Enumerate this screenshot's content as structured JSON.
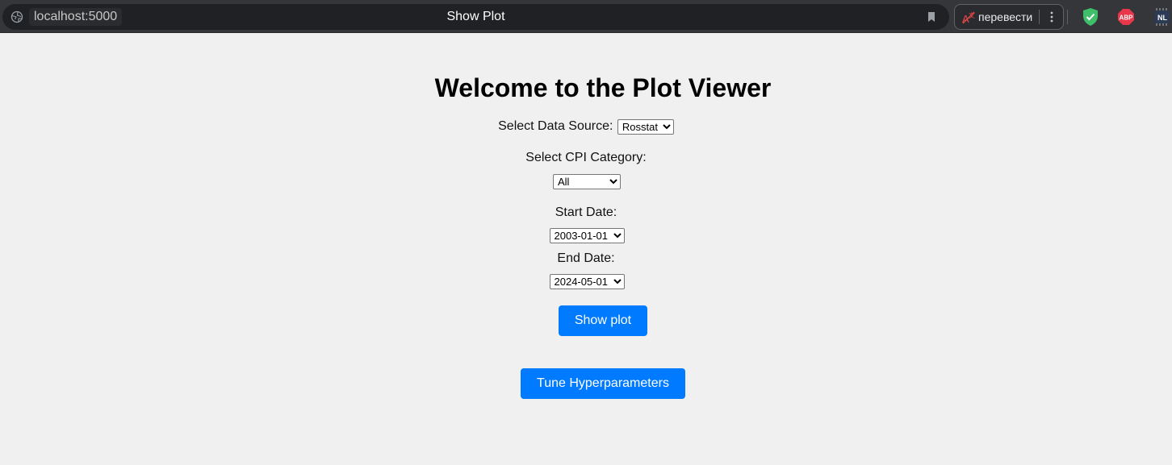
{
  "browser": {
    "url": "localhost:5000",
    "tab_title": "Show Plot",
    "translate_label": "перевести",
    "extensions": [
      {
        "name": "shield-extension",
        "color": "#3fbf6a"
      },
      {
        "name": "adblock-plus",
        "label": "ABP",
        "color": "#e8374a"
      },
      {
        "name": "nl-extension",
        "label": "NL"
      }
    ]
  },
  "page": {
    "heading": "Welcome to the Plot Viewer",
    "data_source": {
      "label": "Select Data Source:",
      "selected": "Rosstat"
    },
    "cpi_category": {
      "label": "Select CPI Category:",
      "selected": "All"
    },
    "start_date": {
      "label": "Start Date:",
      "selected": "2003-01-01"
    },
    "end_date": {
      "label": "End Date:",
      "selected": "2024-05-01"
    },
    "show_plot_button": "Show plot",
    "tune_button": "Tune Hyperparameters",
    "accent_color": "#007bff"
  }
}
